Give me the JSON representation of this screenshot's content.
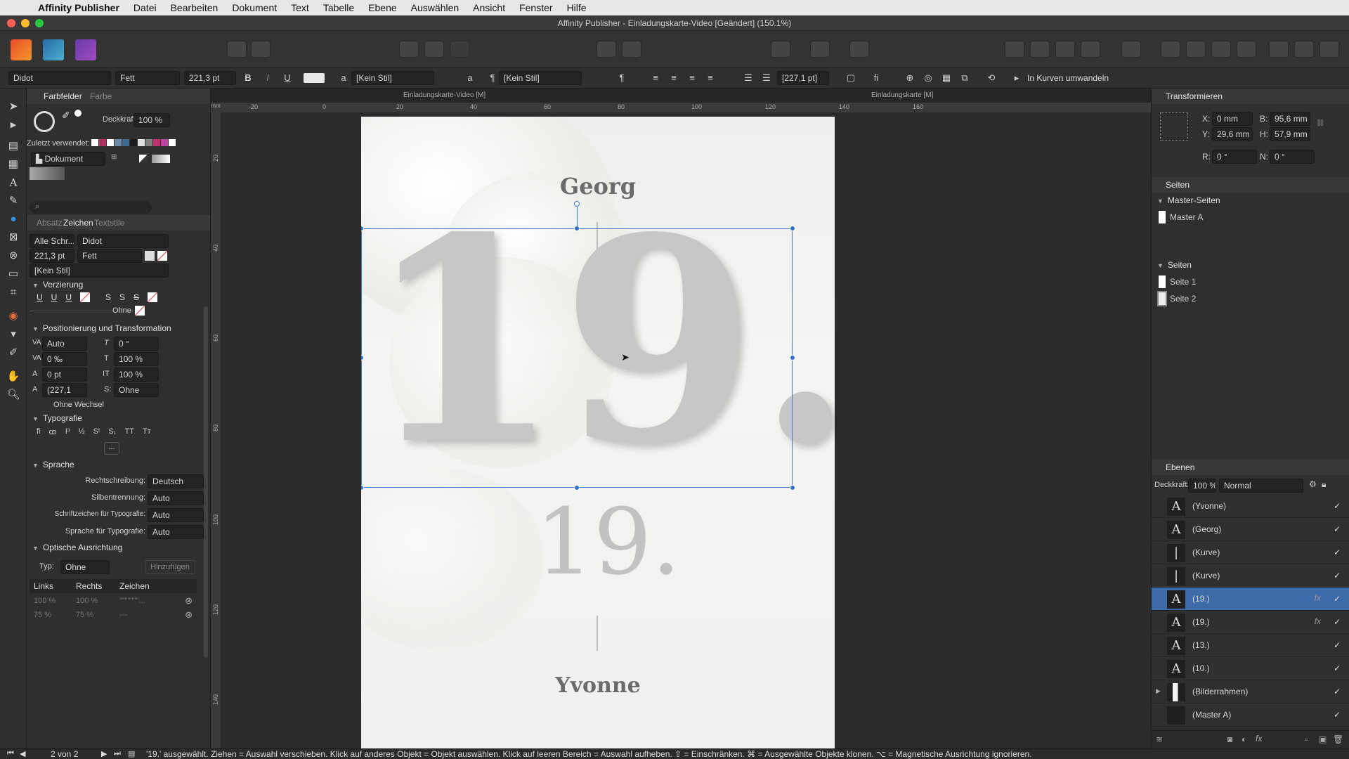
{
  "menubar": {
    "app_name": "Affinity Publisher",
    "items": [
      "Datei",
      "Bearbeiten",
      "Dokument",
      "Text",
      "Tabelle",
      "Ebene",
      "Auswählen",
      "Ansicht",
      "Fenster",
      "Hilfe"
    ]
  },
  "window": {
    "title": "Affinity Publisher - Einladungskarte-Video [Geändert] (150.1%)"
  },
  "toolbar": {
    "convert_label": "In Kurven umwandeln"
  },
  "context_bar": {
    "font_family": "Didot",
    "font_weight": "Fett",
    "font_size": "221,3 pt",
    "bold": "B",
    "italic": "I",
    "underline": "U",
    "char_style": "[Kein Stil]",
    "para_style": "[Kein Stil]",
    "leading": "[227,1 pt]",
    "a_glyph": "a",
    "pilcrow": "¶"
  },
  "swatches_panel": {
    "tabs": [
      "Farbfelder",
      "Farbe"
    ],
    "opacity_label": "Deckkraft:",
    "opacity_value": "100 %",
    "recent_label": "Zuletzt verwendet:",
    "palette": "Dokument",
    "recent_colors": [
      "#ffffff",
      "#b03060",
      "#ffffff",
      "#6a8aa8",
      "#3a6a90",
      "#1a1a1a",
      "#e0e0e0",
      "#808080",
      "#c0306a",
      "#c040a0",
      "#ffffff"
    ]
  },
  "character_panel": {
    "tabs": [
      "Absatz",
      "Zeichen",
      "Textstile"
    ],
    "font_collection": "Alle Schr...",
    "font_family": "Didot",
    "size": "221,3 pt",
    "weight": "Fett",
    "style": "[Kein Stil]",
    "sections": {
      "decoration": "Verzierung",
      "positioning": "Positionierung und Transformation",
      "typography": "Typografie",
      "language": "Sprache",
      "optical": "Optische Ausrichtung"
    },
    "decoration_none": "Ohne",
    "kerning": "Auto",
    "tracking": "0 ‰",
    "baseline": "0 pt",
    "leading": "(227,1",
    "shear": "0 °",
    "vscale": "100 %",
    "hscale": "100 %",
    "tab_align": "Ohne",
    "no_break": "Ohne Wechsel",
    "typo_more": "...",
    "spelling_label": "Rechtschreibung:",
    "spelling_value": "Deutsch",
    "hyph_label": "Silbentrennung:",
    "hyph_value": "Auto",
    "glyph_lang_label": "Schriftzeichen für Typografie:",
    "glyph_lang_value": "Auto",
    "typo_lang_label": "Sprache für Typografie:",
    "typo_lang_value": "Auto",
    "optical_type_label": "Typ:",
    "optical_type_value": "Ohne",
    "optical_add": "Hinzufügen",
    "optical_columns": [
      "Links",
      "Rechts",
      "Zeichen"
    ],
    "optical_row1": [
      "100 %",
      "100 %",
      "\"\"\"\"\"\"\"..."
    ],
    "optical_row2": [
      "75 %",
      "75 %",
      "---"
    ]
  },
  "document": {
    "tab_left": "Einladungskarte-Video [M]",
    "tab_right": "Einladungskarte [M]",
    "name_top": "Georg",
    "name_bottom": "Yvonne",
    "date_big": "19.",
    "date_small": "19.",
    "ruler_h": [
      "-20",
      "0",
      "20",
      "40",
      "60",
      "80",
      "100",
      "120",
      "140",
      "160"
    ],
    "ruler_v": [
      "20",
      "40",
      "60",
      "80",
      "100",
      "120",
      "140"
    ],
    "ruler_unit": "mm"
  },
  "transform_panel": {
    "title": "Transformieren",
    "x_label": "X:",
    "x": "0 mm",
    "y_label": "Y:",
    "y": "29,6 mm",
    "w_label": "B:",
    "w": "95,6 mm",
    "h_label": "H:",
    "h": "57,9 mm",
    "r_label": "R:",
    "r": "0 °",
    "s_label": "N:",
    "s": "0 °"
  },
  "pages_panel": {
    "title": "Seiten",
    "master_header": "Master-Seiten",
    "masters": [
      "Master A"
    ],
    "pages_header": "Seiten",
    "pages": [
      "Seite 1",
      "Seite 2"
    ]
  },
  "layers_panel": {
    "title": "Ebenen",
    "opacity_label": "Deckkraft:",
    "opacity_value": "100 %",
    "blend_mode": "Normal",
    "layers": [
      {
        "name": "(Yvonne)",
        "icon": "A",
        "fx": ""
      },
      {
        "name": "(Georg)",
        "icon": "A",
        "fx": ""
      },
      {
        "name": "(Kurve)",
        "icon": "|",
        "fx": ""
      },
      {
        "name": "(Kurve)",
        "icon": "|",
        "fx": ""
      },
      {
        "name": "(19.)",
        "icon": "A",
        "fx": "fx"
      },
      {
        "name": "(19.)",
        "icon": "A",
        "fx": "fx"
      },
      {
        "name": "(13.)",
        "icon": "A",
        "fx": ""
      },
      {
        "name": "(10.)",
        "icon": "A",
        "fx": ""
      },
      {
        "name": "(Bilderrahmen)",
        "icon": "",
        "fx": ""
      },
      {
        "name": "(Master A)",
        "icon": "",
        "fx": ""
      }
    ],
    "check": "✓"
  },
  "status_bar": {
    "page_indicator": "2 von 2",
    "hint": "'19.' ausgewählt. Ziehen = Auswahl verschieben. Klick auf anderes Objekt = Objekt auswählen. Klick auf leeren Bereich = Auswahl aufheben. ⇧ = Einschränken. ⌘ = Ausgewählte Objekte klonen. ⌥ = Magnetische Ausrichtung ignorieren."
  }
}
